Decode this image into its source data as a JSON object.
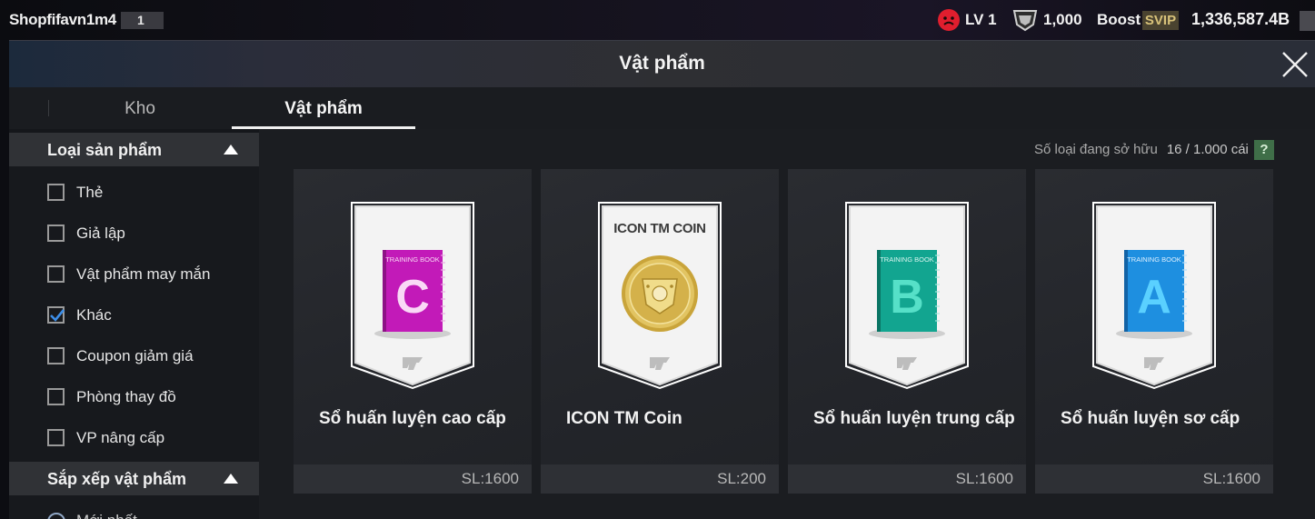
{
  "topbar": {
    "username": "Shopfifavn1m4",
    "user_badge": "1",
    "level": "LV 1",
    "coins": "1,000",
    "boost": "Boost",
    "svip": "SVIP",
    "balance": "1,336,587.4B",
    "level_icon": "sad-face-icon",
    "coin_icon": "shield-coin-icon"
  },
  "header": {
    "title": "Vật phẩm",
    "close_icon": "close-icon"
  },
  "tabs": [
    {
      "label": "Kho",
      "active": false
    },
    {
      "label": "Vật phẩm",
      "active": true
    }
  ],
  "sidebar": {
    "category_section": {
      "label": "Loại sản phẩm",
      "items": [
        {
          "label": "Thẻ",
          "checked": false
        },
        {
          "label": "Giả lập",
          "checked": false
        },
        {
          "label": "Vật phẩm may mắn",
          "checked": false
        },
        {
          "label": "Khác",
          "checked": true
        },
        {
          "label": "Coupon giảm giá",
          "checked": false
        },
        {
          "label": "Phòng thay đồ",
          "checked": false
        },
        {
          "label": "VP nâng cấp",
          "checked": false
        }
      ]
    },
    "sort_section": {
      "label": "Sắp xếp vật phẩm",
      "first_option_partial": "Mới nhất"
    }
  },
  "content": {
    "owned_label": "Số loại đang sở hữu",
    "owned_count": "16 / 1.000 cái",
    "help_label": "?",
    "items": [
      {
        "name": "Sổ huấn luyện cao cấp",
        "qty": "SL:1600",
        "book_letter": "C",
        "book_label": "TRAINING BOOK",
        "color": "#c21ab8"
      },
      {
        "name": "ICON TM Coin",
        "qty": "SL:200",
        "coin_label": "ICON TM COIN",
        "color": "#c9a43a"
      },
      {
        "name": "Sổ huấn luyện trung cấp",
        "qty": "SL:1600",
        "book_letter": "B",
        "book_label": "TRAINING BOOK",
        "color": "#12a590"
      },
      {
        "name": "Sổ huấn luyện sơ cấp",
        "qty": "SL:1600",
        "book_letter": "A",
        "book_label": "TRAINING BOOK",
        "color": "#1e8fe0"
      }
    ]
  }
}
